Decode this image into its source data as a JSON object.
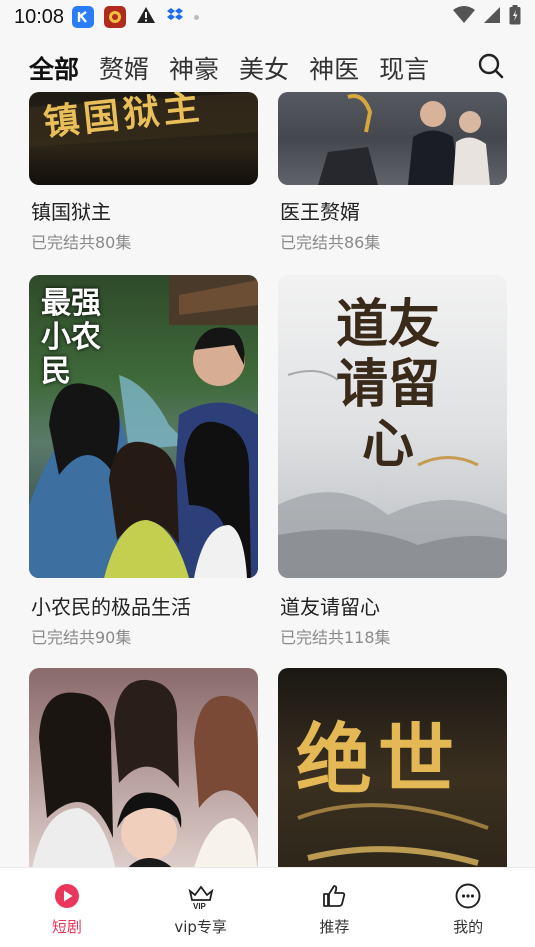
{
  "status_bar": {
    "time": "10:08",
    "icons": [
      "kuaishou-app-icon",
      "app-logo-icon",
      "warning-icon",
      "dropbox-icon",
      "dot-icon",
      "wifi-icon",
      "signal-icon",
      "battery-icon"
    ]
  },
  "tabs": [
    {
      "label": "全部",
      "active": true
    },
    {
      "label": "赘婿",
      "active": false
    },
    {
      "label": "神豪",
      "active": false
    },
    {
      "label": "美女",
      "active": false
    },
    {
      "label": "神医",
      "active": false
    },
    {
      "label": "现言",
      "active": false
    }
  ],
  "search": {
    "icon": "search-icon"
  },
  "dramas": [
    {
      "title": "镇国狱主",
      "episodes": "已完结共80集",
      "poster_text": "镇国狱主"
    },
    {
      "title": "医王赘婿",
      "episodes": "已完结共86集",
      "poster_text": ""
    },
    {
      "title": "小农民的极品生活",
      "episodes": "已完结共90集",
      "poster_text": "最强 小农民"
    },
    {
      "title": "道友请留心",
      "episodes": "已完结共118集",
      "poster_text": "道友 请留心"
    },
    {
      "title": "",
      "episodes": "",
      "poster_text": ""
    },
    {
      "title": "",
      "episodes": "",
      "poster_text": "绝世"
    }
  ],
  "bottom_nav": [
    {
      "label": "短剧",
      "icon": "play-circle-icon",
      "active": true
    },
    {
      "label": "vip专享",
      "icon": "vip-crown-icon",
      "active": false
    },
    {
      "label": "推荐",
      "icon": "thumbs-up-icon",
      "active": false
    },
    {
      "label": "我的",
      "icon": "smile-face-icon",
      "active": false
    }
  ],
  "colors": {
    "accent": "#e8375b",
    "background": "#f7f7f8",
    "subtext": "#8a8a8a"
  }
}
